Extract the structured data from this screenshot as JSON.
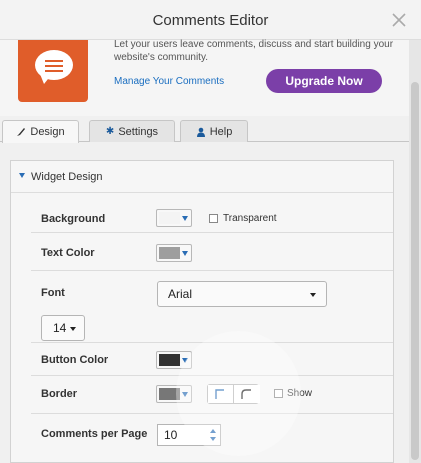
{
  "window": {
    "title": "Comments Editor",
    "close_icon": "close-icon"
  },
  "header": {
    "description": "Let your users leave comments, discuss and start building your website's community.",
    "manage_link": "Manage Your Comments",
    "upgrade_label": "Upgrade Now",
    "app_icon": "speech-bubble-icon",
    "colors": {
      "icon_bg": "#e05d2a",
      "upgrade_bg": "#7b3fa8",
      "link": "#1a6ec0"
    }
  },
  "tabs": [
    {
      "label": "Design",
      "icon": "paintbrush-icon",
      "active": true
    },
    {
      "label": "Settings",
      "icon": "gear-icon",
      "active": false
    },
    {
      "label": "Help",
      "icon": "user-icon",
      "active": false
    }
  ],
  "section": {
    "title": "Widget Design",
    "expanded": true
  },
  "fields": {
    "background": {
      "label": "Background",
      "color": "#f4f4f4",
      "transparent_label": "Transparent",
      "transparent_checked": false
    },
    "text_color": {
      "label": "Text Color",
      "color": "#9e9e9e"
    },
    "font": {
      "label": "Font",
      "family": "Arial",
      "size": "14"
    },
    "button_color": {
      "label": "Button Color",
      "color": "#333333"
    },
    "border": {
      "label": "Border",
      "color": "#777777",
      "show_label": "Show",
      "show_checked": false
    },
    "comments_per_page": {
      "label": "Comments per Page",
      "value": "10"
    }
  }
}
